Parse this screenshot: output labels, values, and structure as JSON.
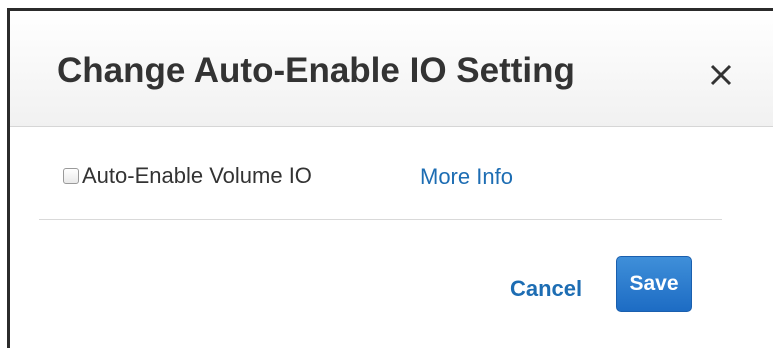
{
  "dialog": {
    "title": "Change Auto-Enable IO Setting",
    "close_icon": "close-icon"
  },
  "option": {
    "label": "Auto-Enable Volume IO",
    "checked": false,
    "more_info_label": "More Info"
  },
  "actions": {
    "cancel_label": "Cancel",
    "save_label": "Save"
  },
  "colors": {
    "link": "#1d6db3",
    "primary_button": "#2a7bd0",
    "title_text": "#333333"
  }
}
